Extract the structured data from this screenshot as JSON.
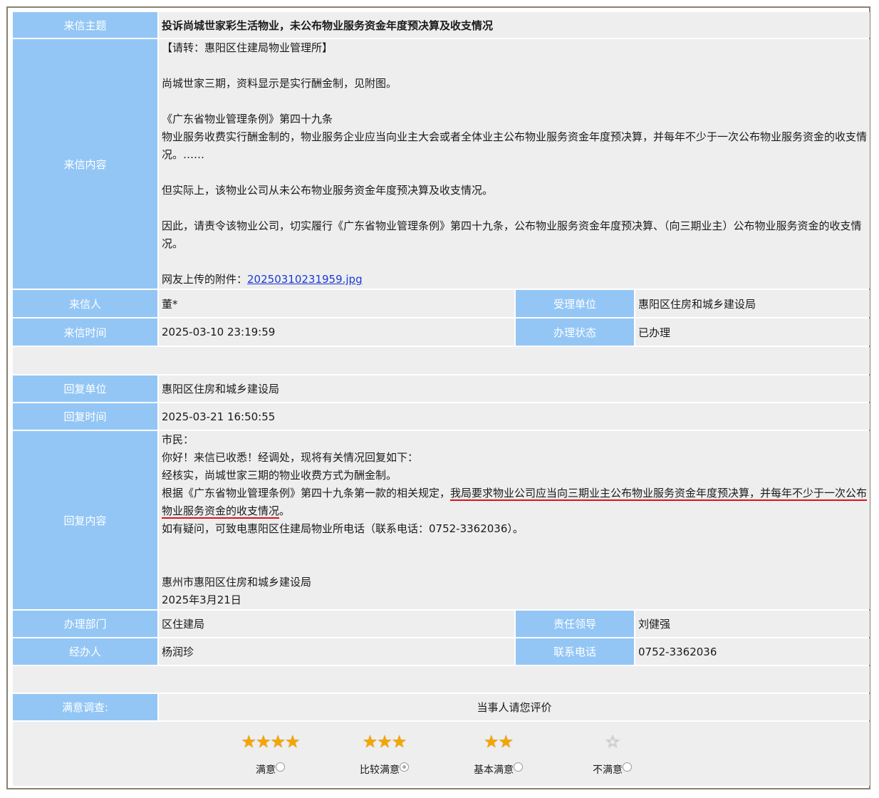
{
  "letter": {
    "subject_label": "来信主题",
    "subject": "投诉尚城世家彩生活物业，未公布物业服务资金年度预决算及收支情况",
    "content_label": "来信内容",
    "content_lines": [
      "【请转：惠阳区住建局物业管理所】",
      "尚城世家三期，资料显示是实行酬金制，见附图。",
      "《广东省物业管理条例》第四十九条",
      "物业服务收费实行酬金制的，物业服务企业应当向业主大会或者全体业主公布物业服务资金年度预决算，并每年不少于一次公布物业服务资金的收支情况。……",
      "但实际上，该物业公司从未公布物业服务资金年度预决算及收支情况。",
      "因此，请责令该物业公司，切实履行《广东省物业管理条例》第四十九条，公布物业服务资金年度预决算、（向三期业主）公布物业服务资金的收支情况。"
    ],
    "attachment_label": "网友上传的附件：",
    "attachment_name": "20250310231959.jpg",
    "sender_label": "来信人",
    "sender": "董*",
    "handler_unit_label": "受理单位",
    "handler_unit": "惠阳区住房和城乡建设局",
    "time_label": "来信时间",
    "time": "2025-03-10 23:19:59",
    "status_label": "办理状态",
    "status": "已办理"
  },
  "reply": {
    "unit_label": "回复单位",
    "unit": "惠阳区住房和城乡建设局",
    "time_label": "回复时间",
    "time": "2025-03-21 16:50:55",
    "content_label": "回复内容",
    "line1": "市民：",
    "line2": "你好！来信已收悉！经调处，现将有关情况回复如下：",
    "line3": "经核实，尚城世家三期的物业收费方式为酬金制。",
    "line4_a": "根据《广东省物业管理条例》第四十九条第一款的相关规定，",
    "line4_b": "我局要求物业公司应当向三期业主公布物业服务资金年度预决算，并每年不少于一次公布",
    "line4_c": "物业服务资金的收支情况",
    "line4_d": "。",
    "line5": "如有疑问，可致电惠阳区住建局物业所电话（联系电话：0752-3362036）。",
    "sign_org": "惠州市惠阳区住房和城乡建设局",
    "sign_date": "2025年3月21日",
    "dept_label": "办理部门",
    "dept": "区住建局",
    "leader_label": "责任领导",
    "leader": "刘健强",
    "handler_label": "经办人",
    "handler": "杨润珍",
    "phone_label": "联系电话",
    "phone": "0752-3362036"
  },
  "survey": {
    "label": "满意调查:",
    "prompt": "当事人请您评价",
    "options": [
      {
        "label": "满意",
        "stars": 4,
        "selected": false
      },
      {
        "label": "比较满意",
        "stars": 3,
        "selected": true
      },
      {
        "label": "基本满意",
        "stars": 2,
        "selected": false
      },
      {
        "label": "不满意",
        "stars": 0,
        "selected": false
      }
    ]
  },
  "colors": {
    "label_bg": "#93c6f5",
    "value_bg": "#eeeeee",
    "subject_red": "#ee0000",
    "underline_red": "#e0101a",
    "frame": "#8a8170"
  }
}
